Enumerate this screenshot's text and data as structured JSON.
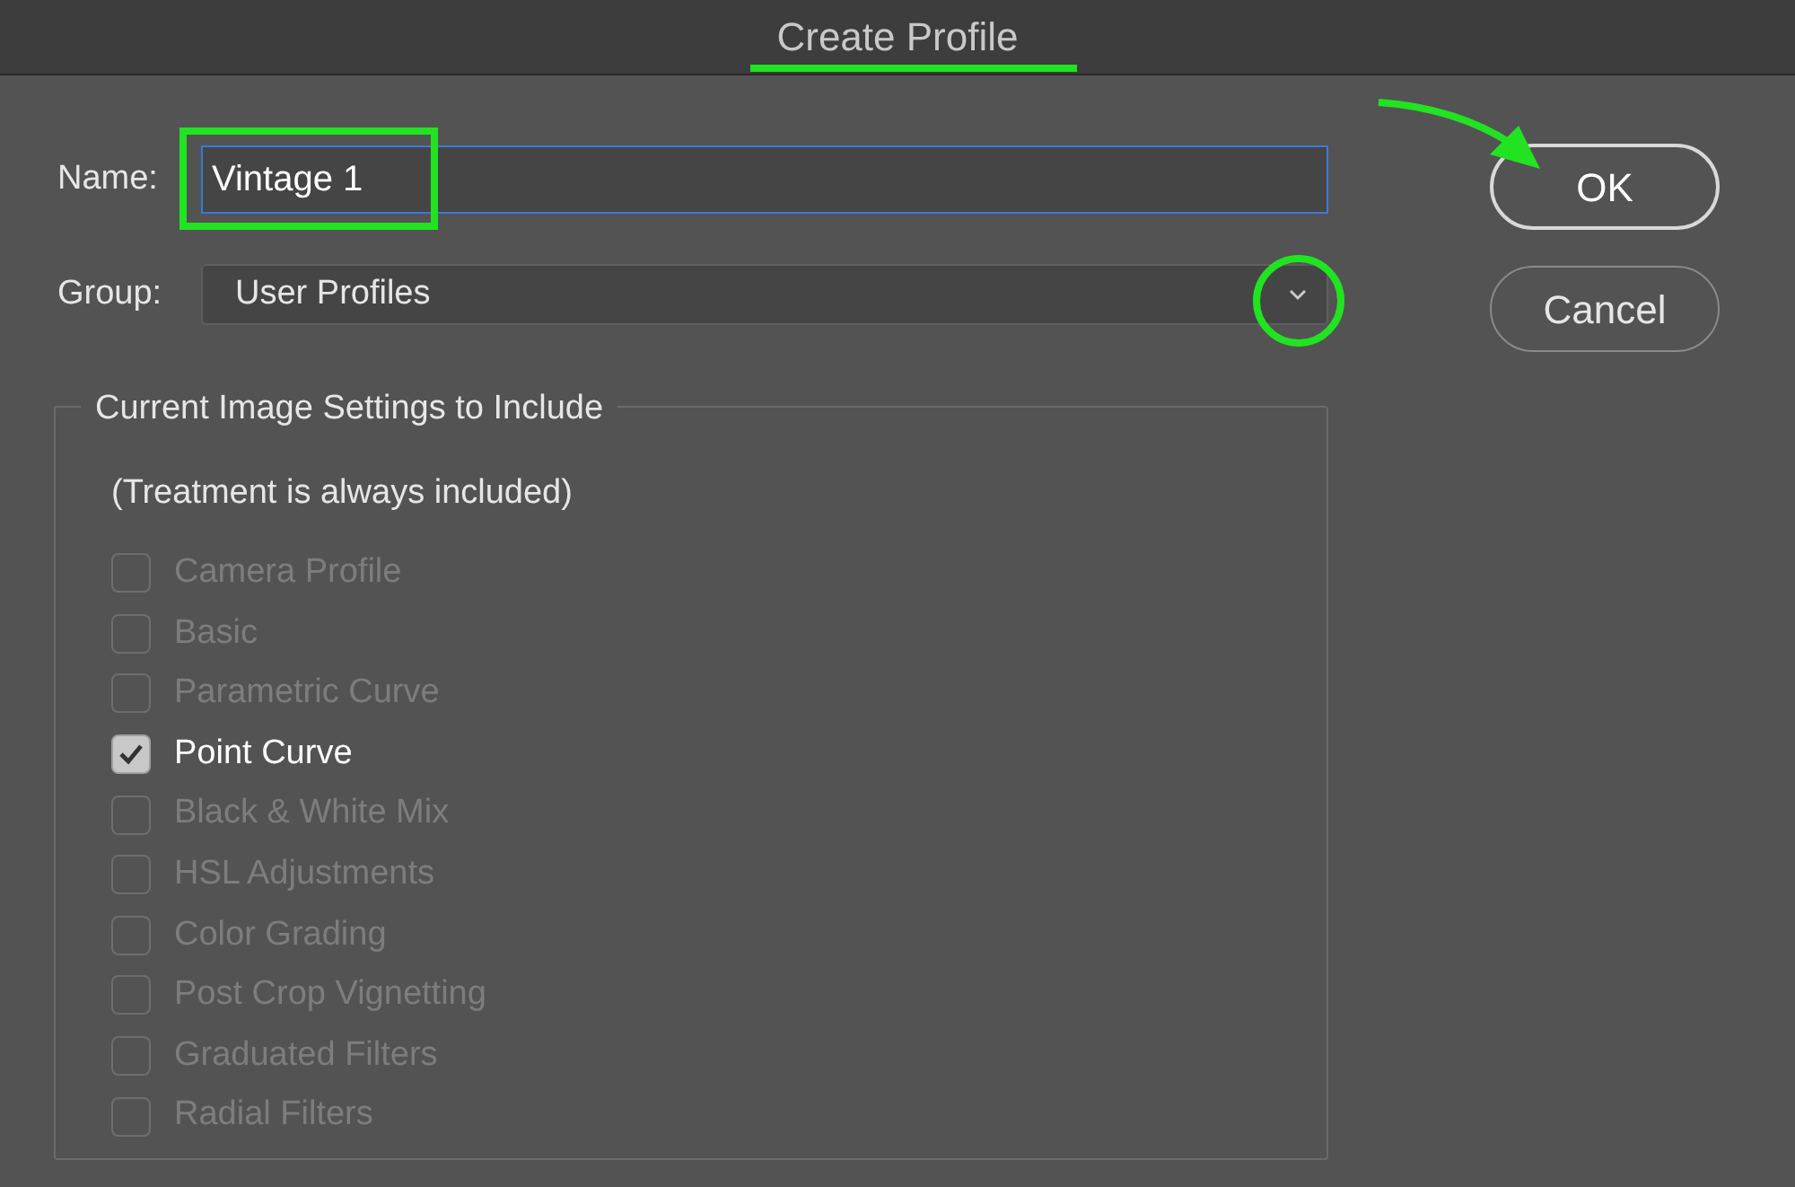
{
  "window": {
    "title": "Create Profile"
  },
  "name_field": {
    "label": "Name:",
    "value": "Vintage 1"
  },
  "group_field": {
    "label": "Group:",
    "value": "User Profiles"
  },
  "settings": {
    "legend": "Current Image Settings to Include",
    "note": "(Treatment is always included)",
    "items": [
      {
        "label": "Camera Profile",
        "checked": false,
        "disabled": true
      },
      {
        "label": "Basic",
        "checked": false,
        "disabled": true
      },
      {
        "label": "Parametric Curve",
        "checked": false,
        "disabled": true
      },
      {
        "label": "Point Curve",
        "checked": true,
        "disabled": false
      },
      {
        "label": "Black & White Mix",
        "checked": false,
        "disabled": true
      },
      {
        "label": "HSL Adjustments",
        "checked": false,
        "disabled": true
      },
      {
        "label": "Color Grading",
        "checked": false,
        "disabled": true
      },
      {
        "label": "Post Crop Vignetting",
        "checked": false,
        "disabled": true
      },
      {
        "label": "Graduated Filters",
        "checked": false,
        "disabled": true
      },
      {
        "label": "Radial Filters",
        "checked": false,
        "disabled": true
      }
    ]
  },
  "buttons": [
    "OK",
    "Cancel"
  ]
}
